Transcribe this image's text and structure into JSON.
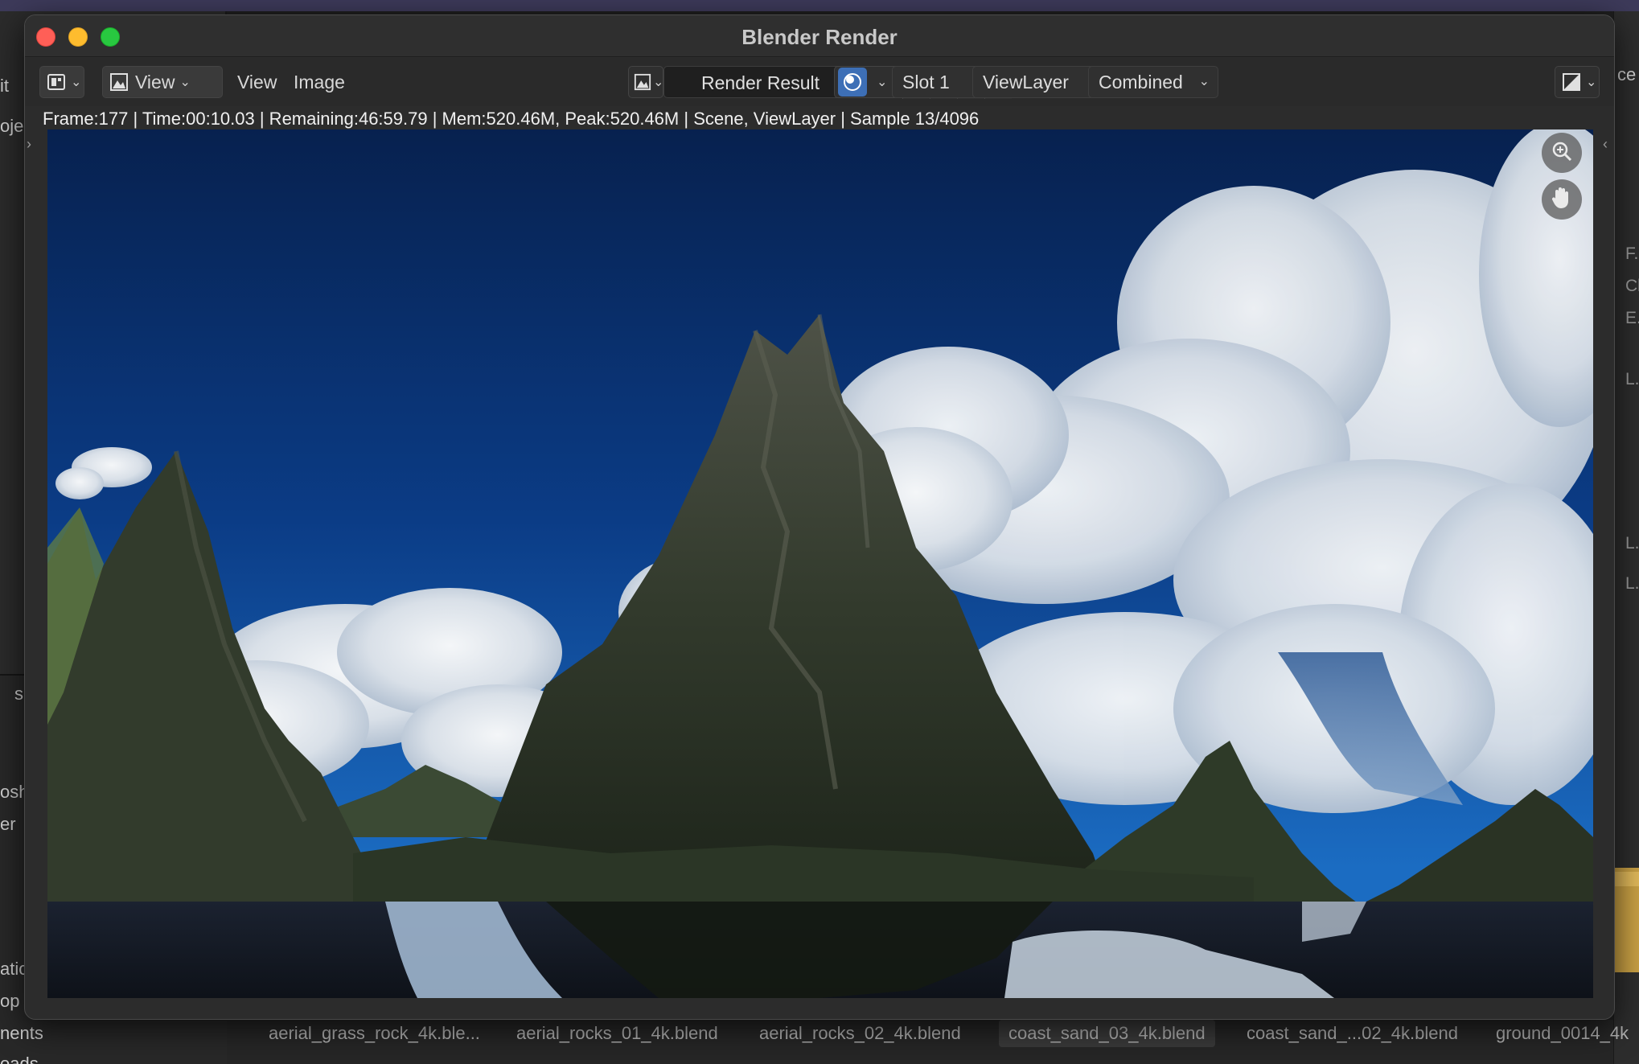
{
  "background": {
    "left_panel": [
      "it",
      "oje",
      "s",
      "osh",
      "er",
      "atic",
      "op",
      "nents",
      "oads"
    ],
    "right_panel": [
      "ce",
      "F...",
      "Cl",
      "E...",
      "L...",
      "L...",
      "L..."
    ],
    "file_browser": [
      "aerial_grass_rock_4k.ble...",
      "aerial_rocks_01_4k.blend",
      "aerial_rocks_02_4k.blend",
      "coast_sand_03_4k.blend",
      "coast_sand_...02_4k.blend",
      "ground_0014_4k"
    ]
  },
  "window": {
    "title": "Blender Render"
  },
  "toolbar": {
    "editor_type_icon": "image-editor-icon",
    "view_mode_label": "View",
    "menu_view": "View",
    "menu_image": "Image",
    "image_name": "Render Result",
    "slot": "Slot 1",
    "view_layer": "ViewLayer",
    "pass": "Combined"
  },
  "status": {
    "text": "Frame:177 | Time:00:10.03 | Remaining:46:59.79 | Mem:520.46M, Peak:520.46M | Scene, ViewLayer | Sample 13/4096"
  },
  "colors": {
    "sky_top": "#0a2f72",
    "accent_blue": "#3d6fb6",
    "window_bg": "#2c2c2c"
  }
}
